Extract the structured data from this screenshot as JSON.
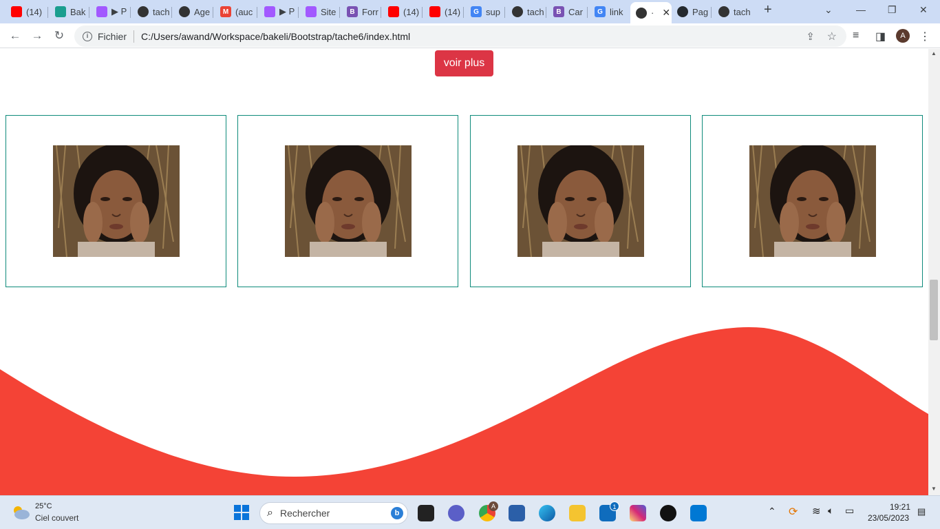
{
  "browser": {
    "tabs": [
      {
        "title": "(14)",
        "icon": "youtube-icon",
        "color": "#ff0000"
      },
      {
        "title": "Bak",
        "icon": "bakeli-icon",
        "color": "#1a9e8f"
      },
      {
        "title": "▶ P",
        "icon": "figma-icon",
        "color": "#a259ff"
      },
      {
        "title": "tach",
        "icon": "globe-icon",
        "color": "#333333"
      },
      {
        "title": "Age",
        "icon": "globe-icon",
        "color": "#333333"
      },
      {
        "title": "(auc",
        "icon": "gmail-icon",
        "color": "#ea4335"
      },
      {
        "title": "▶ P",
        "icon": "figma-icon",
        "color": "#a259ff"
      },
      {
        "title": "Site",
        "icon": "figma-icon",
        "color": "#a259ff"
      },
      {
        "title": "Forr",
        "icon": "bootstrap-icon",
        "color": "#7952b3"
      },
      {
        "title": "(14)",
        "icon": "youtube-icon",
        "color": "#ff0000"
      },
      {
        "title": "(14)",
        "icon": "youtube-icon",
        "color": "#ff0000"
      },
      {
        "title": "sup",
        "icon": "google-icon",
        "color": "#4285f4"
      },
      {
        "title": "tach",
        "icon": "globe-icon",
        "color": "#333333"
      },
      {
        "title": "Car",
        "icon": "bootstrap-icon",
        "color": "#7952b3"
      },
      {
        "title": "link",
        "icon": "google-icon",
        "color": "#4285f4"
      },
      {
        "title": "·",
        "icon": "globe-icon",
        "color": "#333333",
        "active": true
      },
      {
        "title": "Pag",
        "icon": "github-icon",
        "color": "#24292e"
      },
      {
        "title": "tach",
        "icon": "globe-icon",
        "color": "#333333"
      }
    ],
    "new_tab": "+",
    "address": {
      "scheme_label": "Fichier",
      "url": "C:/Users/awand/Workspace/bakeli/Bootstrap/tache6/index.html"
    },
    "profile_initial": "A"
  },
  "page": {
    "button_label": "voir plus",
    "accent_color": "#dc3545",
    "wave_color": "#f44336",
    "card_border_color": "#0d8a7a",
    "cards": [
      {
        "image": "portrait-photo"
      },
      {
        "image": "portrait-photo"
      },
      {
        "image": "portrait-photo"
      },
      {
        "image": "portrait-photo"
      }
    ]
  },
  "taskbar": {
    "weather_temp": "25°C",
    "weather_desc": "Ciel couvert",
    "search_placeholder": "Rechercher",
    "time": "19:21",
    "date": "23/05/2023",
    "badges": {
      "chrome": "A",
      "mail": "1"
    }
  }
}
